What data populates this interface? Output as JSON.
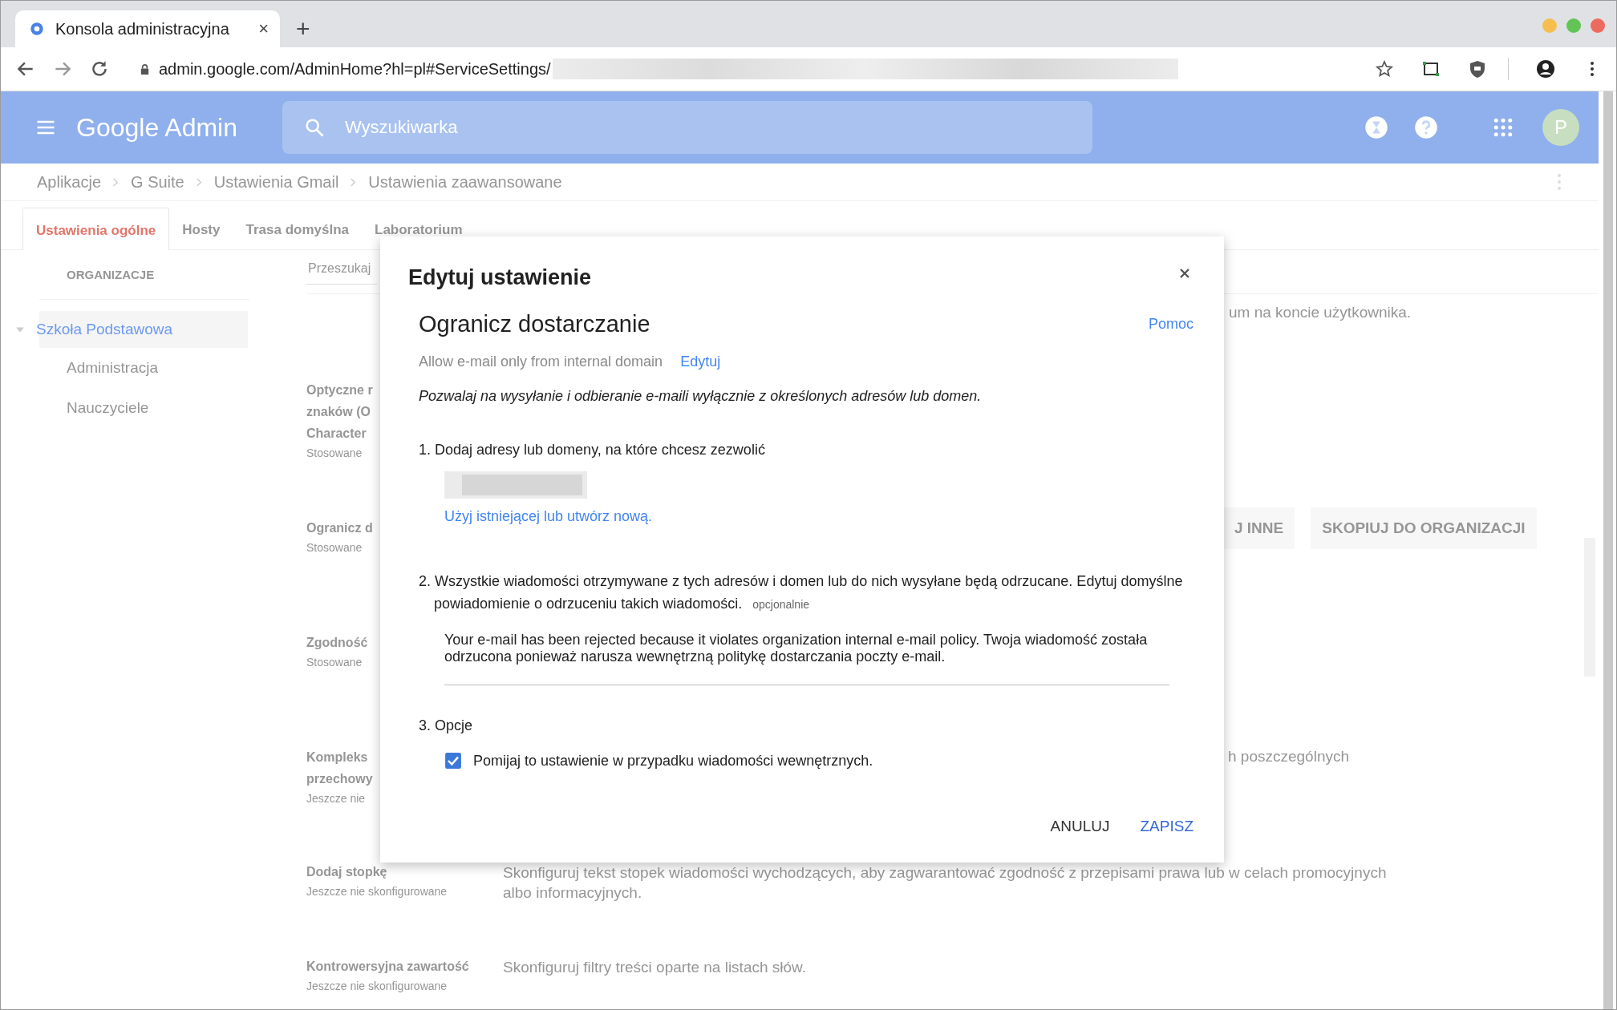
{
  "browser": {
    "tab": {
      "title": "Konsola administracyjna",
      "close": "×"
    },
    "new_tab": "+",
    "url": "admin.google.com/AdminHome?hl=pl#ServiceSettings/"
  },
  "header": {
    "logo": "Google Admin",
    "search": {
      "placeholder": "Wyszukiwarka"
    },
    "avatar": "P"
  },
  "breadcrumb": [
    "Aplikacje",
    "G Suite",
    "Ustawienia Gmail",
    "Ustawienia zaawansowane"
  ],
  "tabs": [
    {
      "label": "Ustawienia ogólne",
      "selected": true
    },
    {
      "label": "Hosty",
      "selected": false
    },
    {
      "label": "Trasa domyślna",
      "selected": false
    },
    {
      "label": "Laboratorium",
      "selected": false
    }
  ],
  "sidebar": {
    "heading": "ORGANIZACJE",
    "items": [
      {
        "label": "Szkoła Podstawowa",
        "selected": true,
        "expanded": true,
        "children": [
          {
            "label": "Administracja",
            "selected": false
          },
          {
            "label": "Nauczyciele",
            "selected": false
          }
        ]
      }
    ]
  },
  "content": {
    "search": {
      "placeholder": "Przeszukaj"
    },
    "intro_tail": "um na koncie użytkownika.",
    "settings": [
      {
        "name_lines": [
          "Optyczne r",
          "znaków (O",
          "Character"
        ],
        "status": "Stosowane"
      },
      {
        "name_lines": [
          "Ogranicz d"
        ],
        "status": "Stosowane",
        "buttons": [
          "J INNE",
          "SKOPIUJ DO ORGANIZACJI"
        ]
      },
      {
        "name_lines": [
          "Zgodność"
        ],
        "status": "Stosowane"
      },
      {
        "name_lines": [
          "Kompleks",
          "przechowy"
        ],
        "status": "Jeszcze nie",
        "description_tail": "h poszczególnych"
      },
      {
        "name_lines": [
          "Dodaj stopkę"
        ],
        "status": "Jeszcze nie skonfigurowane",
        "description": "Skonfiguruj tekst stopek wiadomości wychodzących, aby zagwarantować zgodność z przepisami prawa lub w celach promocyjnych albo informacyjnych."
      },
      {
        "name_lines": [
          "Kontrowersyjna zawartość"
        ],
        "status": "Jeszcze nie skonfigurowane",
        "description": "Skonfiguruj filtry treści oparte na listach słów."
      }
    ]
  },
  "dialog": {
    "title": "Edytuj ustawienie",
    "setting_name": "Ogranicz dostarczanie",
    "help_link": "Pomoc",
    "summary": "Allow e-mail only from internal domain",
    "summary_link": "Edytuj",
    "description": "Pozwalaj na wysyłanie i odbieranie e-maili wyłącznie z określonych adresów lub domen.",
    "step_1": "1. Dodaj adresy lub domeny, na które chcesz zezwolić",
    "step_1_link": "Użyj istniejącej lub utwórz nową.",
    "step_2": "2. Wszystkie wiadomości otrzymywane z tych adresów i domen lub do nich wysyłane będą odrzucane. Edytuj domyślne powiadomienie o odrzuceniu takich wiadomości.",
    "step_2_hint": "opcjonalnie",
    "rejection_message": "Your e-mail has been rejected because it violates organization internal e-mail policy. Twoja wiadomość została odrzucona ponieważ narusza wewnętrzną politykę dostarczania poczty e-mail.",
    "step_3": "3. Opcje",
    "options": [
      {
        "label": "Pomijaj to ustawienie w przypadku wiadomości wewnętrznych.",
        "checked": true
      }
    ],
    "buttons": [
      "ANULUJ",
      "ZAPISZ"
    ]
  }
}
